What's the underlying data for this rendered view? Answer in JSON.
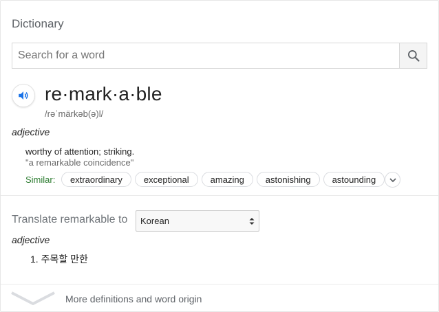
{
  "dictionary": {
    "title": "Dictionary",
    "search": {
      "placeholder": "Search for a word"
    },
    "entry": {
      "word": "re·mark·a·ble",
      "phonetic": "/rəˈmärkəb(ə)l/",
      "part_of_speech": "adjective",
      "definition": "worthy of attention; striking.",
      "example": "\"a remarkable coincidence\"",
      "similar_label": "Similar:",
      "similar": [
        "extraordinary",
        "exceptional",
        "amazing",
        "astonishing",
        "astounding"
      ]
    },
    "translate": {
      "label": "Translate remarkable to",
      "language": "Korean",
      "part_of_speech": "adjective",
      "result": "1. 주목할 만한"
    },
    "more_link": "More definitions and word origin"
  }
}
